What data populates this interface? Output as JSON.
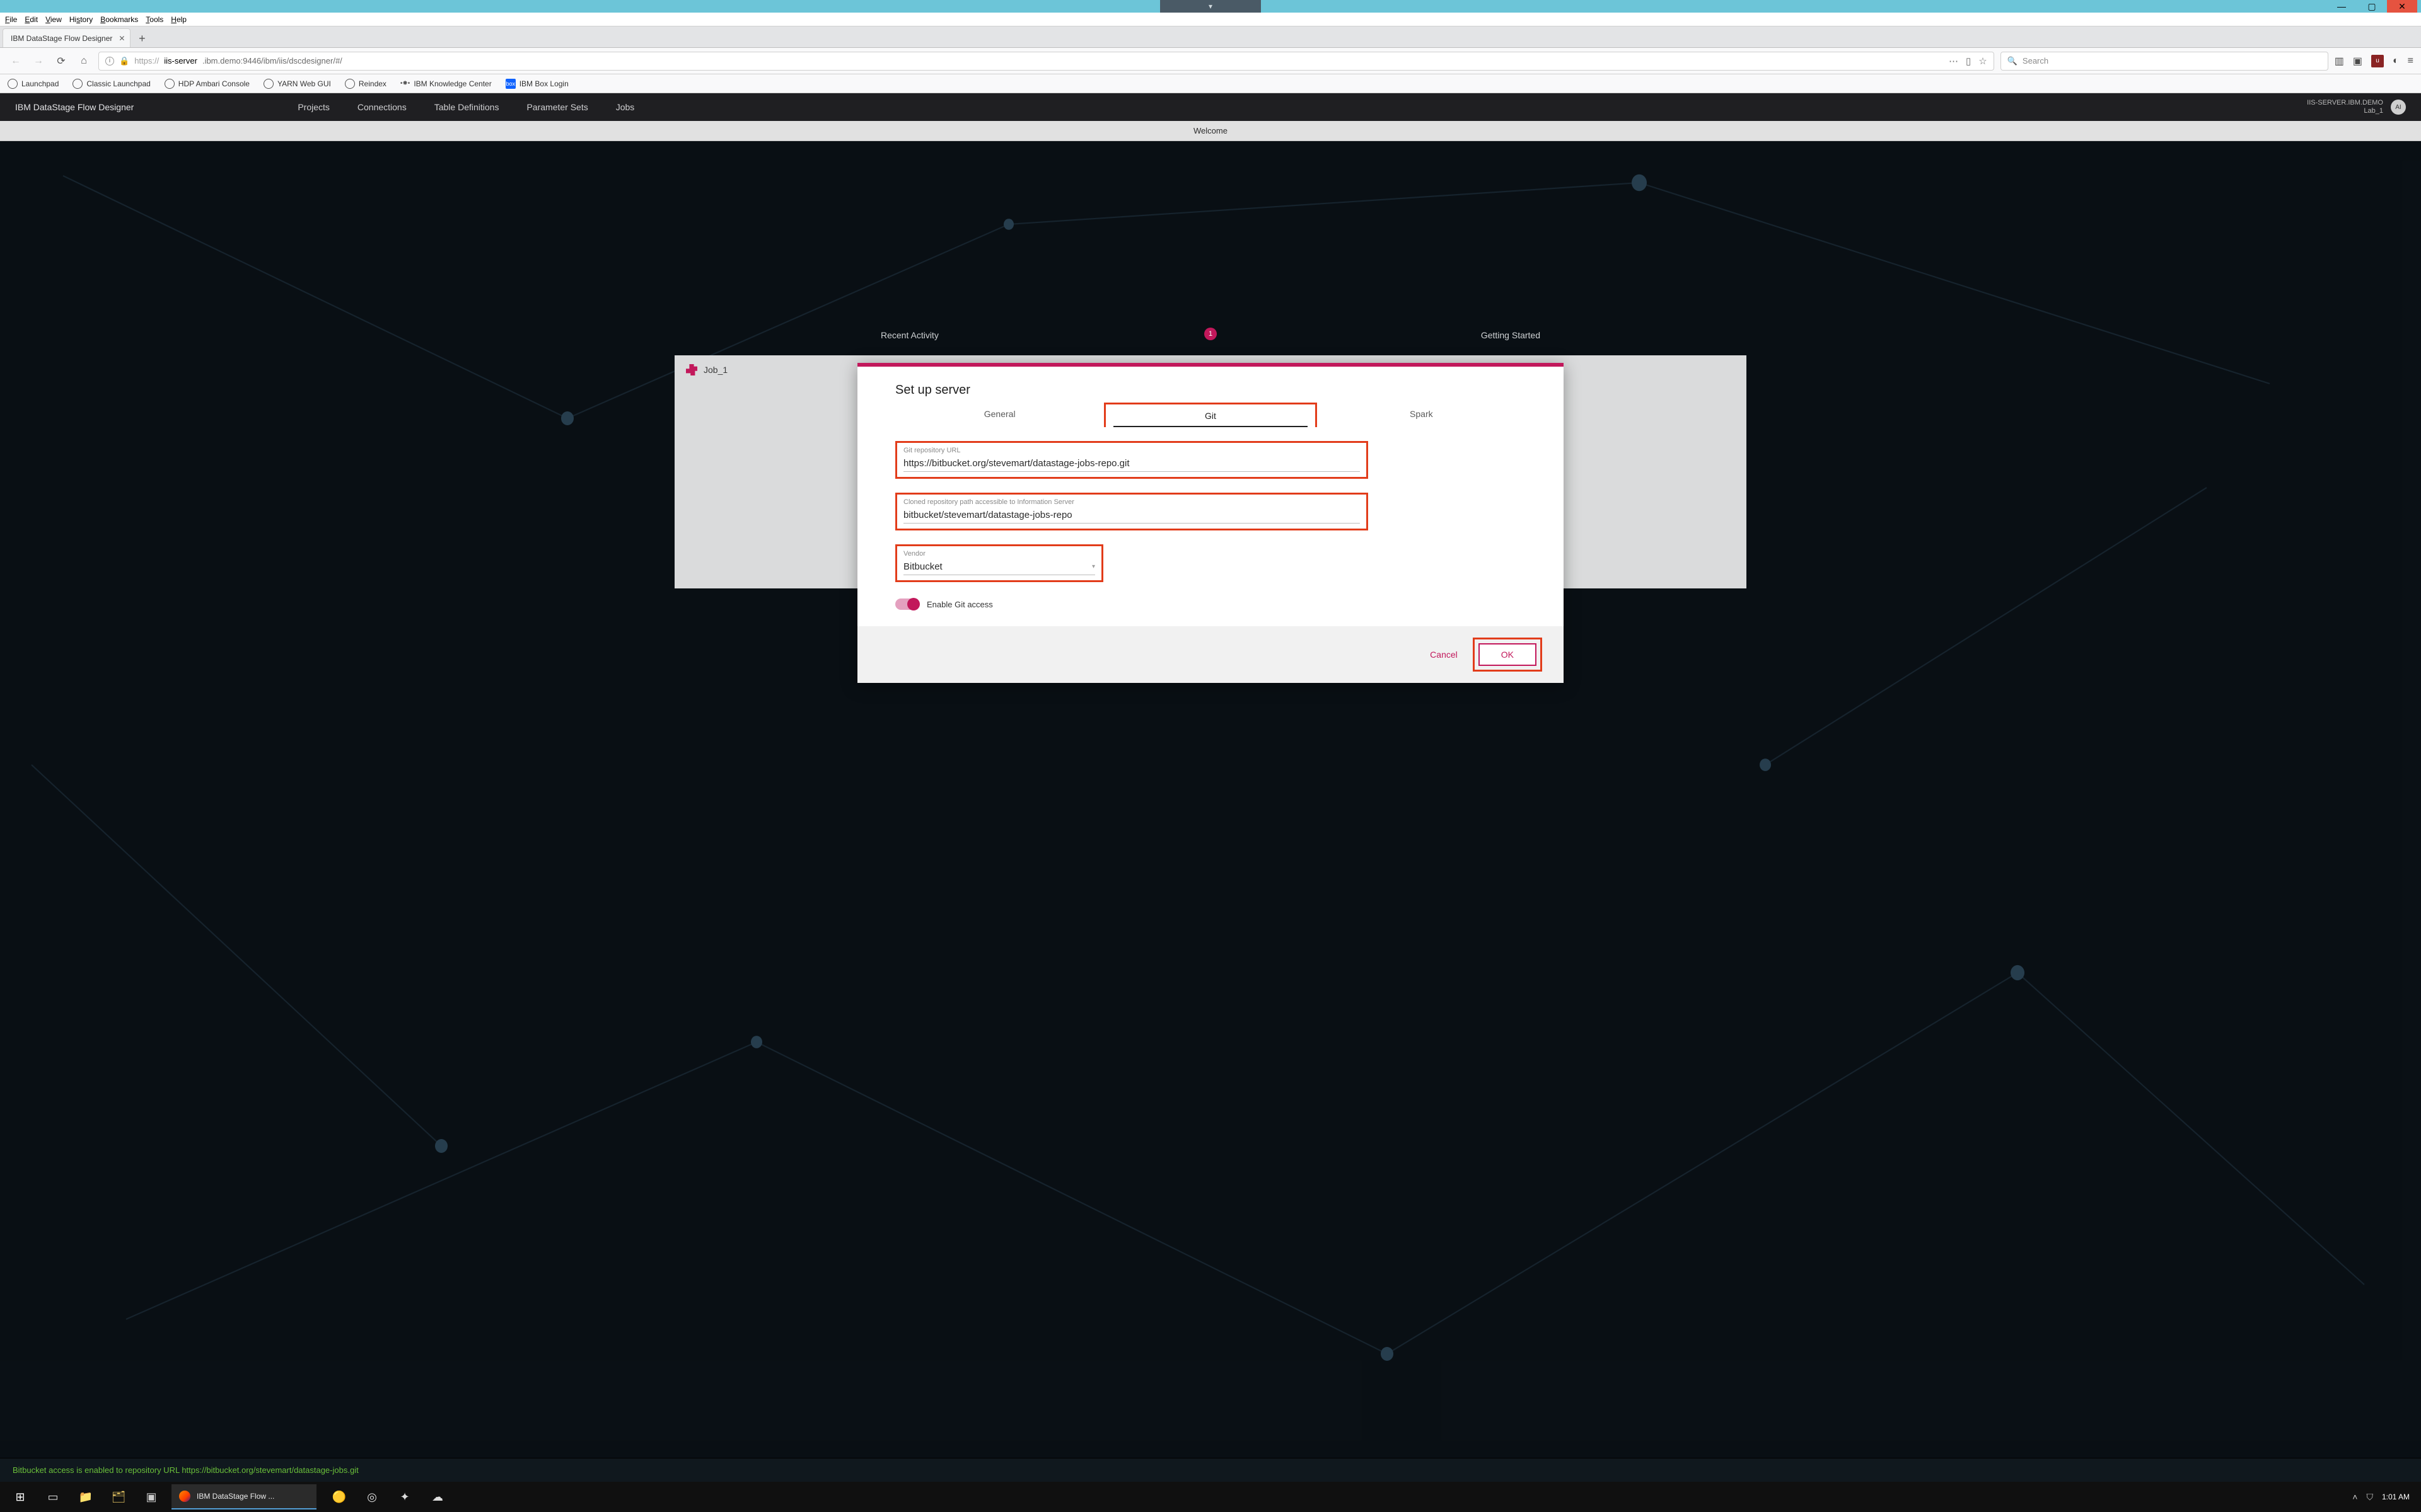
{
  "window": {
    "min": "—",
    "max": "▢",
    "close": "✕"
  },
  "menubar": [
    "File",
    "Edit",
    "View",
    "History",
    "Bookmarks",
    "Tools",
    "Help"
  ],
  "tab": {
    "title": "IBM DataStage Flow Designer"
  },
  "url": {
    "lock": "🔒",
    "proto": "https://",
    "host": "iis-server",
    "rest": ".ibm.demo:9446/ibm/iis/dscdesigner/#/"
  },
  "search_placeholder": "Search",
  "bookmarks": [
    {
      "label": "Launchpad",
      "icon": "globe"
    },
    {
      "label": "Classic Launchpad",
      "icon": "globe"
    },
    {
      "label": "HDP Ambari Console",
      "icon": "globe"
    },
    {
      "label": "YARN Web GUI",
      "icon": "globe"
    },
    {
      "label": "Reindex",
      "icon": "globe"
    },
    {
      "label": "IBM Knowledge Center",
      "icon": "kc"
    },
    {
      "label": "IBM Box Login",
      "icon": "box"
    }
  ],
  "app": {
    "title": "IBM DataStage Flow Designer",
    "nav": [
      "Projects",
      "Connections",
      "Table Definitions",
      "Parameter Sets",
      "Jobs"
    ],
    "server": "IIS-SERVER.IBM.DEMO",
    "project": "Lab_1",
    "avatar": "AI"
  },
  "welcome": "Welcome",
  "sections": {
    "recent": "Recent Activity",
    "start": "Getting Started",
    "badge": "1"
  },
  "job": {
    "name": "Job_1"
  },
  "modal": {
    "title": "Set up server",
    "tabs": {
      "general": "General",
      "git": "Git",
      "spark": "Spark"
    },
    "git": {
      "repo_label": "Git repository URL",
      "repo_value": "https://bitbucket.org/stevemart/datastage-jobs-repo.git",
      "clone_label": "Cloned repository path accessible to Information Server",
      "clone_value": "bitbucket/stevemart/datastage-jobs-repo",
      "vendor_label": "Vendor",
      "vendor_value": "Bitbucket",
      "toggle_label": "Enable Git access"
    },
    "cancel": "Cancel",
    "ok": "OK"
  },
  "status": "Bitbucket access is enabled to repository URL https://bitbucket.org/stevemart/datastage-jobs.git",
  "taskbar": {
    "active": "IBM DataStage Flow ...",
    "time": "1:01 AM"
  }
}
